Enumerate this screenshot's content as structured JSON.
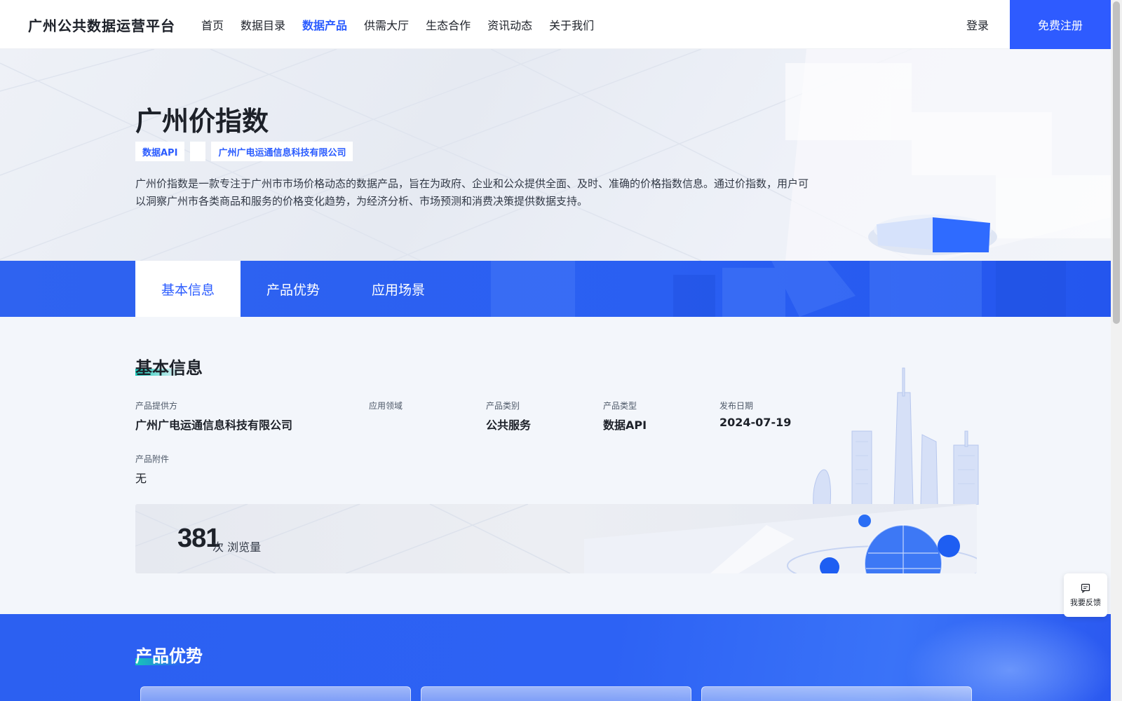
{
  "header": {
    "brand": "广州公共数据运营平台",
    "nav": [
      {
        "label": "首页",
        "active": false
      },
      {
        "label": "数据目录",
        "active": false
      },
      {
        "label": "数据产品",
        "active": true
      },
      {
        "label": "供需大厅",
        "active": false
      },
      {
        "label": "生态合作",
        "active": false
      },
      {
        "label": "资讯动态",
        "active": false
      },
      {
        "label": "关于我们",
        "active": false
      }
    ],
    "login": "登录",
    "register": "免费注册"
  },
  "hero": {
    "title": "广州价指数",
    "tags": [
      "数据API",
      "",
      "广州广电运通信息科技有限公司"
    ],
    "description": "广州价指数是一款专注于广州市市场价格动态的数据产品，旨在为政府、企业和公众提供全面、及时、准确的价格指数信息。通过价指数，用户可以洞察广州市各类商品和服务的价格变化趋势，为经济分析、市场预测和消费决策提供数据支持。"
  },
  "tabs": [
    {
      "label": "基本信息",
      "active": true
    },
    {
      "label": "产品优势",
      "active": false
    },
    {
      "label": "应用场景",
      "active": false
    }
  ],
  "basic_info": {
    "title": "基本信息",
    "fields": {
      "provider": {
        "label": "产品提供方",
        "value": "广州广电运通信息科技有限公司"
      },
      "domain": {
        "label": "应用领域",
        "value": ""
      },
      "category": {
        "label": "产品类别",
        "value": "公共服务"
      },
      "type": {
        "label": "产品类型",
        "value": "数据API"
      },
      "date": {
        "label": "发布日期",
        "value": "2024-07-19"
      },
      "attachment": {
        "label": "产品附件",
        "value": "无"
      }
    },
    "views": {
      "count": "381",
      "label": "次 浏览量"
    }
  },
  "advantages": {
    "title": "产品优势"
  },
  "feedback": {
    "label": "我要反馈",
    "icon": "feedback-icon"
  },
  "colors": {
    "accent": "#2e5bff",
    "underline": "#16c7b7"
  }
}
